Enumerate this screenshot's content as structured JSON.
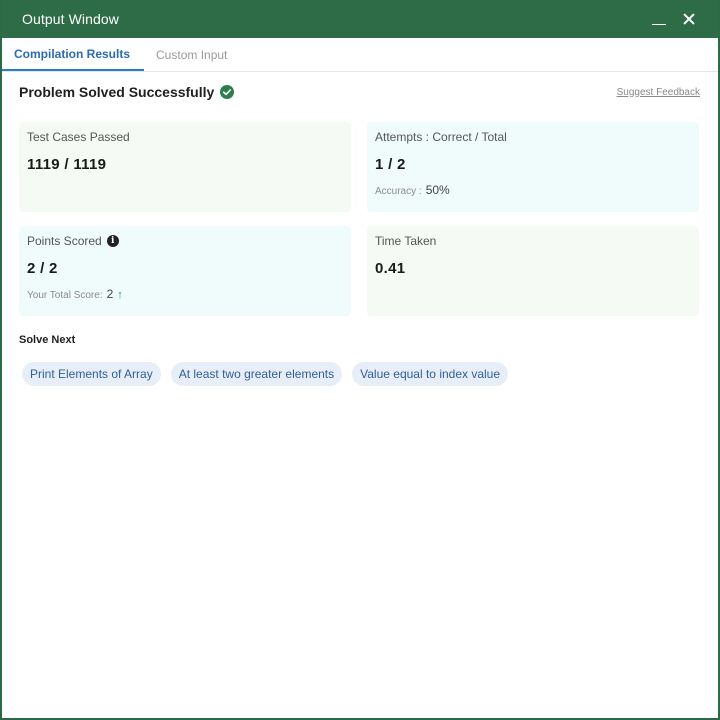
{
  "window": {
    "title": "Output Window",
    "accent_color": "#2e6c47"
  },
  "tabs": [
    {
      "label": "Compilation Results",
      "active": true
    },
    {
      "label": "Custom Input",
      "active": false
    }
  ],
  "result": {
    "status": "Problem Solved Successfully",
    "status_icon": "check-circle-icon",
    "feedback_link": "Suggest Feedback"
  },
  "cards": {
    "test_cases": {
      "label": "Test Cases Passed",
      "value": "1119 / 1119"
    },
    "attempts": {
      "label": "Attempts : Correct / Total",
      "value": "1 / 2",
      "sub_label": "Accuracy :",
      "sub_value": "50%"
    },
    "points": {
      "label": "Points Scored",
      "value": "2 / 2",
      "sub_label": "Your Total Score:",
      "sub_value": "2",
      "info_icon": "info-icon",
      "trend_icon": "arrow-up-icon"
    },
    "time": {
      "label": "Time Taken",
      "value": "0.41"
    }
  },
  "solve_next": {
    "heading": "Solve Next",
    "items": [
      "Print Elements of Array",
      "At least two greater elements",
      "Value equal to index value"
    ]
  }
}
